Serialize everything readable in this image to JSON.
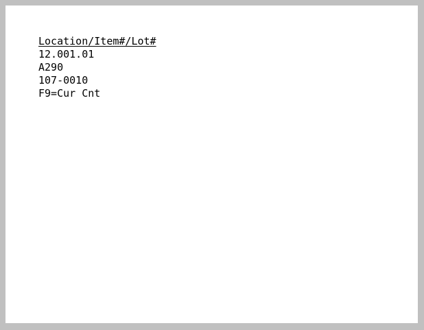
{
  "terminal": {
    "header": "Location/Item#/Lot#",
    "location": "12.001.01",
    "item": "A290",
    "lot": "107-0010",
    "function_key": "F9=Cur Cnt"
  }
}
